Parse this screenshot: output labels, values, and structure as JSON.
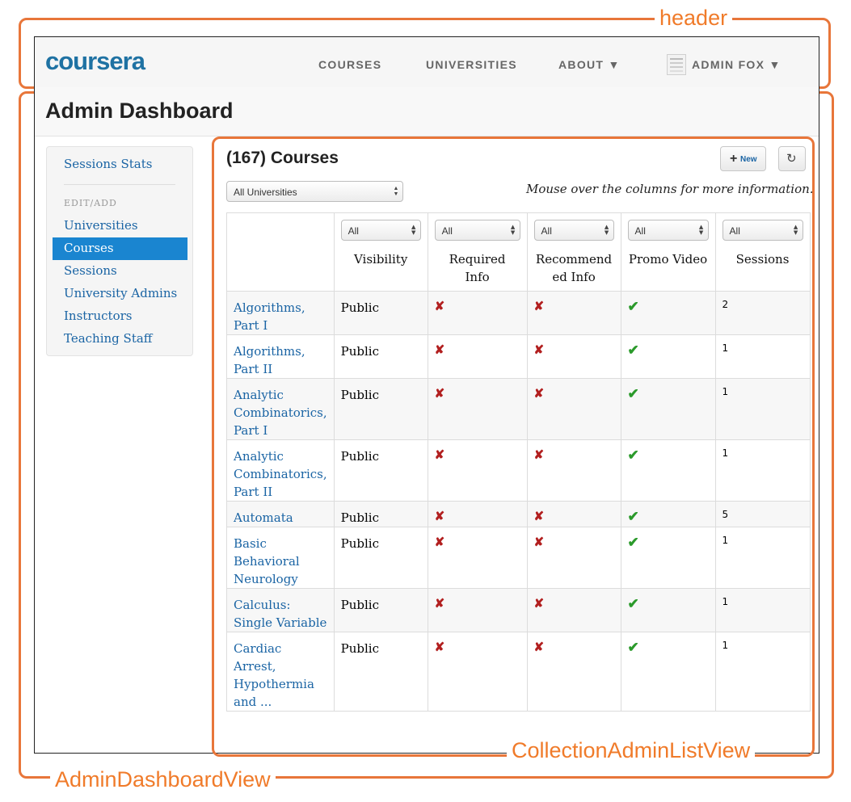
{
  "annotations": {
    "header": "header",
    "dashboard": "AdminDashboardView",
    "list": "CollectionAdminListView"
  },
  "header": {
    "logo": "coursera",
    "nav": [
      "COURSES",
      "UNIVERSITIES",
      "ABOUT ▼"
    ],
    "user": "ADMIN FOX ▼"
  },
  "page": {
    "title": "Admin Dashboard"
  },
  "sidebar": {
    "stats": "Sessions Stats",
    "heading": "EDIT/ADD",
    "items": [
      "Universities",
      "Courses",
      "Sessions",
      "University Admins",
      "Instructors",
      "Teaching Staff"
    ],
    "active": "Courses"
  },
  "list": {
    "heading": "(167) Courses",
    "new_label": "New",
    "new_icon": "plus-icon",
    "refresh_icon": "share-icon",
    "filter_value": "All Universities",
    "hint": "Mouse over the columns for more information.",
    "columns": [
      {
        "label": "Visibility",
        "filter": "All"
      },
      {
        "label": "Required Info",
        "filter": "All"
      },
      {
        "label": "Recommend ed Info",
        "filter": "All"
      },
      {
        "label": "Promo Video",
        "filter": "All"
      },
      {
        "label": "Sessions",
        "filter": "All"
      }
    ],
    "marks": {
      "no": "✘",
      "yes": "✔"
    },
    "rows": [
      {
        "name": "Algorithms, Part I",
        "visibility": "Public",
        "required": false,
        "recommended": false,
        "promo": true,
        "sessions": "2"
      },
      {
        "name": "Algorithms, Part II",
        "visibility": "Public",
        "required": false,
        "recommended": false,
        "promo": true,
        "sessions": "1"
      },
      {
        "name": "Analytic Combinatorics, Part I",
        "visibility": "Public",
        "required": false,
        "recommended": false,
        "promo": true,
        "sessions": "1"
      },
      {
        "name": "Analytic Combinatorics, Part II",
        "visibility": "Public",
        "required": false,
        "recommended": false,
        "promo": true,
        "sessions": "1"
      },
      {
        "name": "Automata",
        "visibility": "Public",
        "required": false,
        "recommended": false,
        "promo": true,
        "sessions": "5"
      },
      {
        "name": "Basic Behavioral Neurology",
        "visibility": "Public",
        "required": false,
        "recommended": false,
        "promo": true,
        "sessions": "1"
      },
      {
        "name": "Calculus: Single Variable",
        "visibility": "Public",
        "required": false,
        "recommended": false,
        "promo": true,
        "sessions": "1"
      },
      {
        "name": "Cardiac Arrest, Hypothermia and ...",
        "visibility": "Public",
        "required": false,
        "recommended": false,
        "promo": true,
        "sessions": "1"
      }
    ]
  },
  "colors": {
    "annotation": "#e8763a",
    "link": "#1a64a4",
    "active": "#1a85d0",
    "logo": "#1f72a3"
  }
}
